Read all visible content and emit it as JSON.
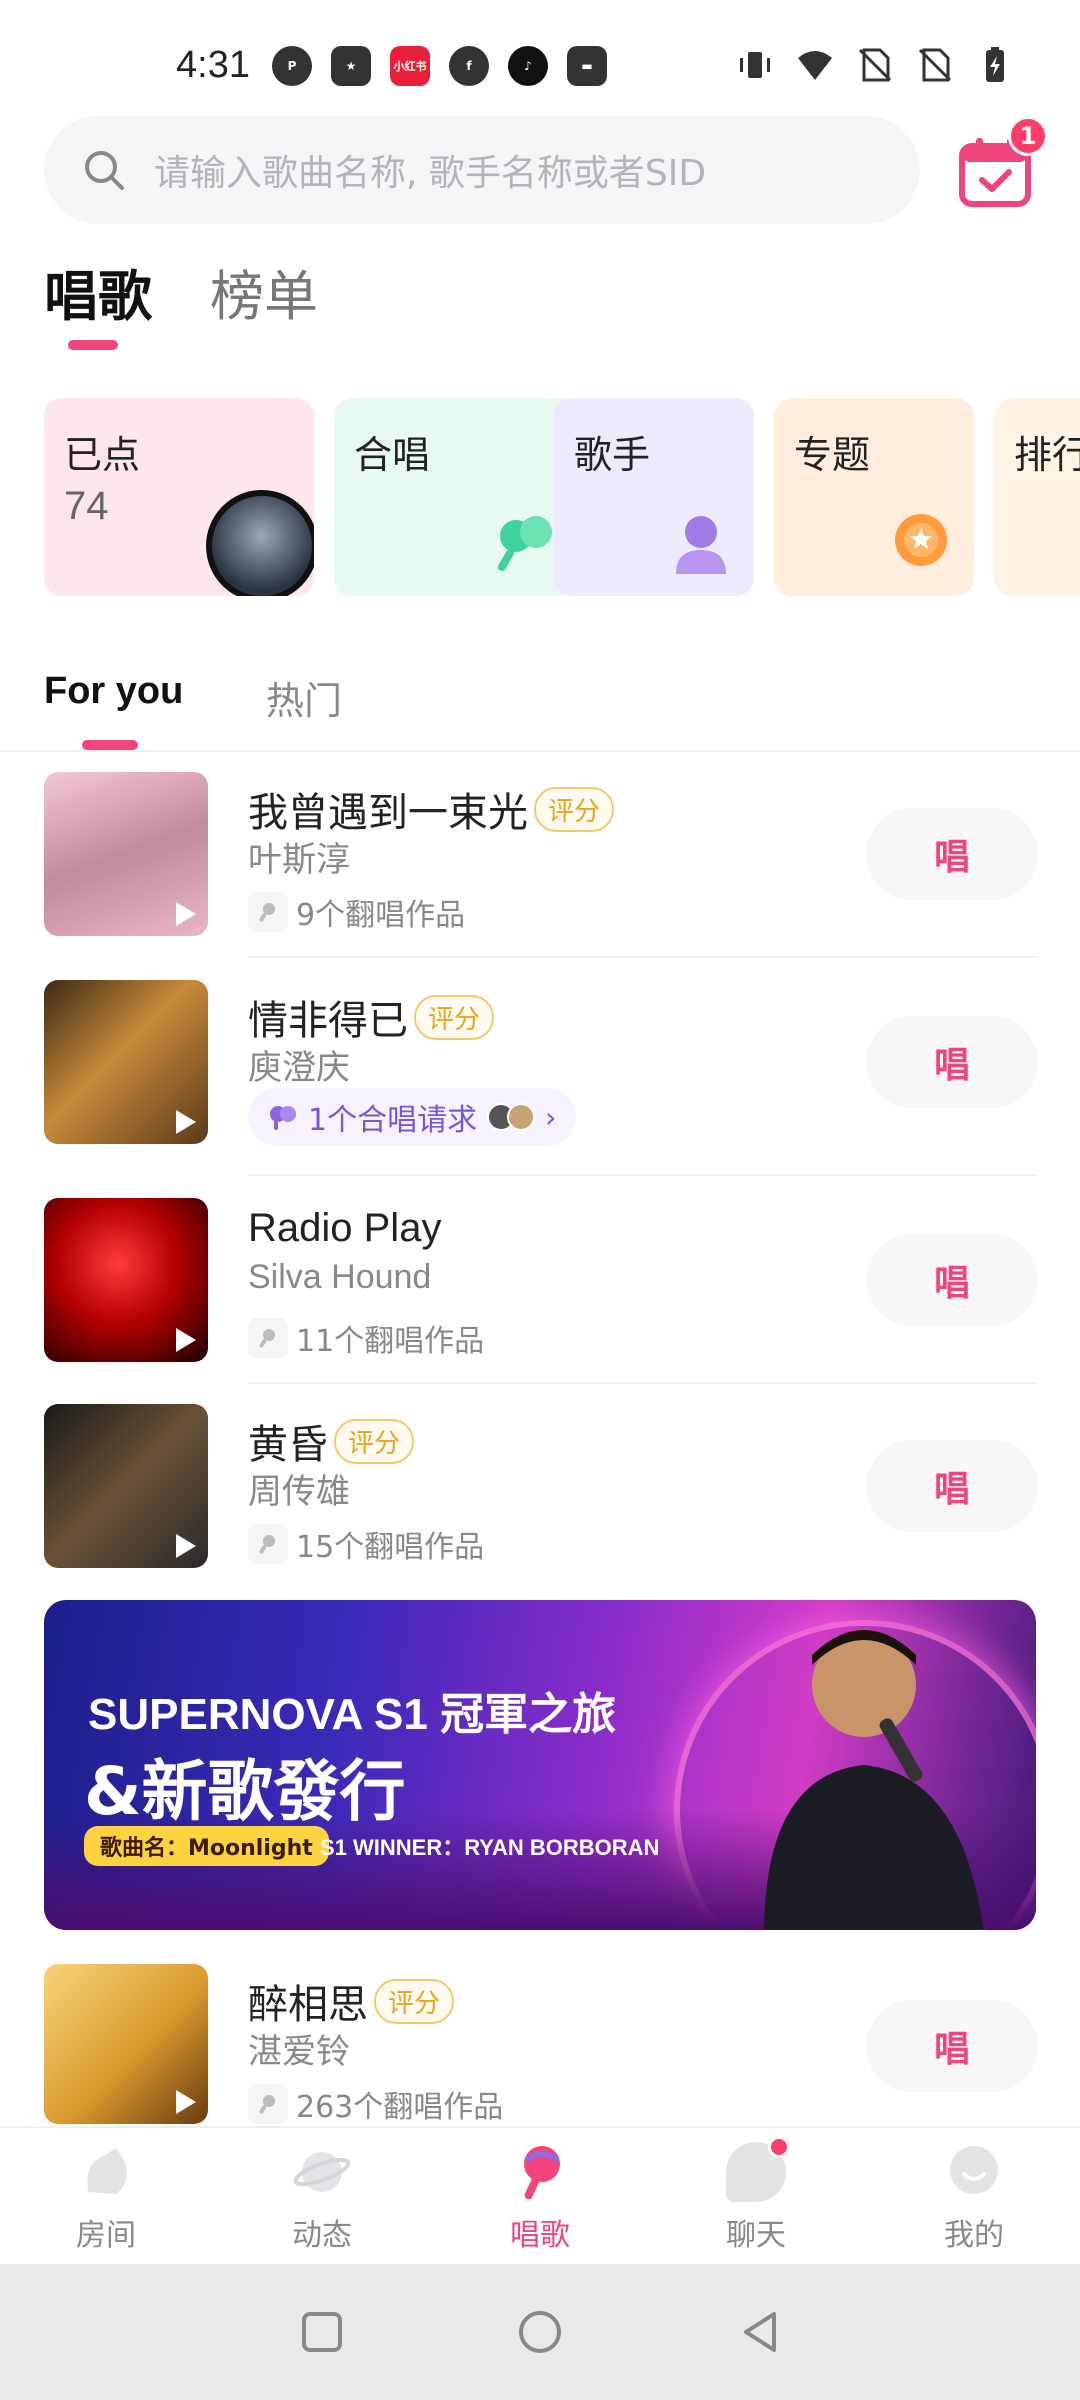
{
  "status_bar": {
    "time": "4:31",
    "left_icons": [
      "p-app-icon",
      "star-app-icon",
      "xiaohongshu-icon",
      "facebook-icon",
      "tiktok-icon",
      "wallet-icon"
    ],
    "xiaohongshu_label": "小红书",
    "right_icons": [
      "vibrate-icon",
      "wifi-icon",
      "no-sim-icon",
      "no-sim-icon",
      "battery-charging-icon"
    ]
  },
  "search": {
    "placeholder": "请输入歌曲名称, 歌手名称或者SID"
  },
  "calendar": {
    "badge": "1"
  },
  "main_tabs": [
    {
      "label": "唱歌",
      "active": true
    },
    {
      "label": "榜单",
      "active": false
    }
  ],
  "category_cards": [
    {
      "title": "已点",
      "count": "74",
      "color": "#fde6ee"
    },
    {
      "title": "合唱",
      "color": "#e6faf1"
    },
    {
      "title": "歌手",
      "color": "#eeeafd"
    },
    {
      "title": "专题",
      "color": "#ffeedd"
    },
    {
      "title": "排行",
      "color": "#fff3e6"
    }
  ],
  "sub_tabs": [
    {
      "label": "For you",
      "active": true
    },
    {
      "label": "热门",
      "active": false
    }
  ],
  "songs": [
    {
      "title": "我曾遇到一束光",
      "badge": "评分",
      "artist": "叶斯淳",
      "covers": "9个翻唱作品",
      "sing": "唱"
    },
    {
      "title": "情非得已",
      "badge": "评分",
      "artist": "庾澄庆",
      "chorus": "1个合唱请求",
      "sing": "唱"
    },
    {
      "title": "Radio Play",
      "artist": "Silva Hound",
      "covers": "11个翻唱作品",
      "sing": "唱"
    },
    {
      "title": "黄昏",
      "badge": "评分",
      "artist": "周传雄",
      "covers": "15个翻唱作品",
      "sing": "唱"
    },
    {
      "title": "醉相思",
      "badge": "评分",
      "artist": "湛爱铃",
      "covers": "263个翻唱作品",
      "sing": "唱"
    }
  ],
  "banner": {
    "line1": "SUPERNOVA S1 冠軍之旅",
    "line2": "&新歌發行",
    "song_label": "歌曲名：Moonlight",
    "winner": "S1 WINNER：RYAN BORBORAN"
  },
  "bottom_nav": [
    {
      "label": "房间",
      "icon": "room-icon"
    },
    {
      "label": "动态",
      "icon": "planet-icon"
    },
    {
      "label": "唱歌",
      "icon": "mic-icon",
      "active": true
    },
    {
      "label": "聊天",
      "icon": "chat-icon",
      "dot": true
    },
    {
      "label": "我的",
      "icon": "profile-icon"
    }
  ],
  "colors": {
    "accent": "#f0457a",
    "badge_red": "#ff3d6a",
    "rate_gold": "#e5a51e",
    "chorus_purple": "#7b55d9"
  }
}
